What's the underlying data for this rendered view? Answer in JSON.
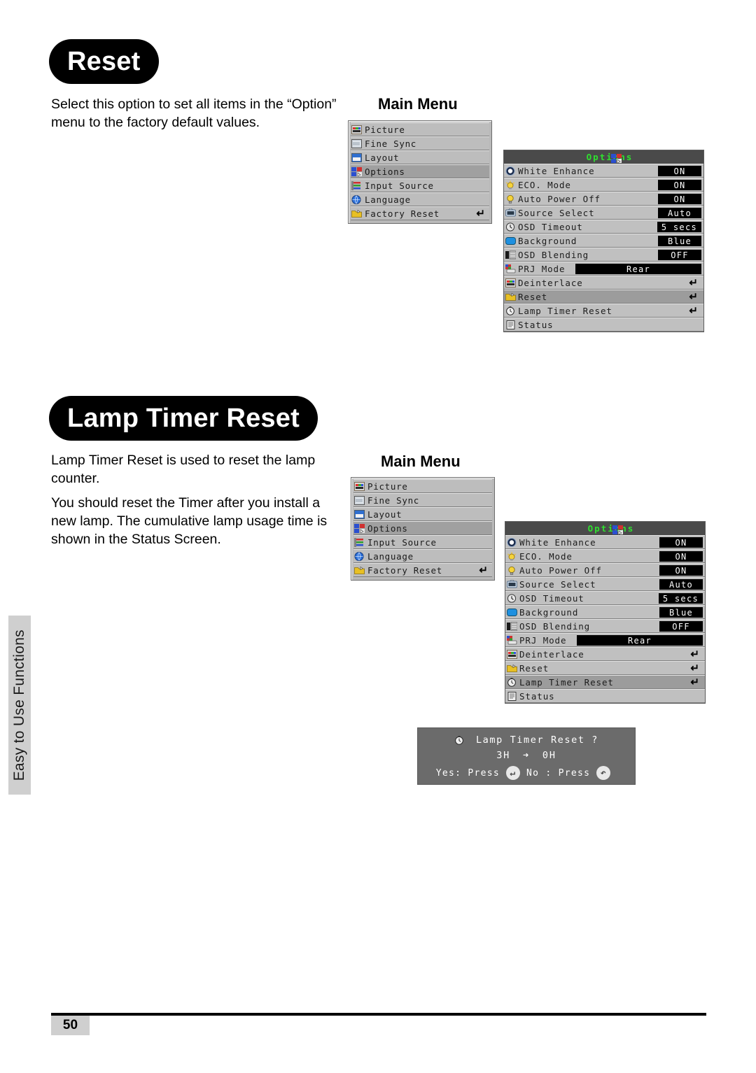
{
  "page": {
    "number": "50",
    "side_tab": "Easy to Use Functions"
  },
  "sections": [
    {
      "heading": "Reset",
      "paragraphs": [
        "Select this option to set all items in the “Option” menu to the factory default values."
      ],
      "menu_caption": "Main Menu"
    },
    {
      "heading": "Lamp Timer Reset",
      "paragraphs": [
        "Lamp Timer Reset is used to reset the lamp counter.",
        "You should reset the Timer after you install a new lamp. The cumulative lamp usage time is shown in the Status Screen."
      ],
      "menu_caption": "Main Menu"
    }
  ],
  "main_menu": {
    "items": [
      {
        "label": "Picture",
        "icon": "picture-icon",
        "selected": false,
        "enter": ""
      },
      {
        "label": "Fine Sync",
        "icon": "fine-sync-icon",
        "selected": false,
        "enter": ""
      },
      {
        "label": "Layout",
        "icon": "layout-icon",
        "selected": false,
        "enter": ""
      },
      {
        "label": "Options",
        "icon": "options-icon",
        "selected": true,
        "enter": ""
      },
      {
        "label": "Input Source",
        "icon": "input-source-icon",
        "selected": false,
        "enter": ""
      },
      {
        "label": "Language",
        "icon": "language-icon",
        "selected": false,
        "enter": ""
      },
      {
        "label": "Factory Reset",
        "icon": "folder-icon",
        "selected": false,
        "enter": "↵"
      }
    ]
  },
  "options_menu": {
    "title": "Options",
    "title_icon": "options-icon",
    "rows": [
      {
        "label": "White Enhance",
        "icon": "white-enhance-icon",
        "value": "ON",
        "value_wide": false,
        "enter": ""
      },
      {
        "label": "ECO. Mode",
        "icon": "eco-mode-icon",
        "value": "ON",
        "value_wide": false,
        "enter": ""
      },
      {
        "label": "Auto Power Off",
        "icon": "lamp-icon",
        "value": "ON",
        "value_wide": false,
        "enter": ""
      },
      {
        "label": "Source Select",
        "icon": "source-select-icon",
        "value": "Auto",
        "value_wide": false,
        "enter": ""
      },
      {
        "label": "OSD Timeout",
        "icon": "clock-icon",
        "value": "5 secs",
        "value_wide": false,
        "enter": ""
      },
      {
        "label": "Background",
        "icon": "background-icon",
        "value": "Blue",
        "value_wide": false,
        "enter": ""
      },
      {
        "label": "OSD Blending",
        "icon": "osd-blending-icon",
        "value": "OFF",
        "value_wide": false,
        "enter": ""
      },
      {
        "label": "PRJ Mode",
        "icon": "prj-mode-icon",
        "value": "Rear",
        "value_wide": true,
        "enter": ""
      },
      {
        "label": "Deinterlace",
        "icon": "deinterlace-icon",
        "value": "",
        "value_wide": false,
        "enter": "↵"
      },
      {
        "label": "Reset",
        "icon": "folder-icon",
        "value": "",
        "value_wide": false,
        "enter": "↵"
      },
      {
        "label": "Lamp Timer Reset",
        "icon": "timer-icon",
        "value": "",
        "value_wide": false,
        "enter": "↵"
      },
      {
        "label": "Status",
        "icon": "status-icon",
        "value": "",
        "value_wide": false,
        "enter": ""
      }
    ],
    "selected_row_top": "Reset",
    "selected_row_bottom": "Lamp Timer Reset"
  },
  "lamp_dialog": {
    "icon": "timer-icon",
    "title": "Lamp Timer Reset ?",
    "from_hours": "3H",
    "arrow": "➜",
    "to_hours": "0H",
    "yes_label": "Yes: Press",
    "yes_button_icon": "enter-button-icon",
    "yes_button_glyph": "↵",
    "no_label": "No : Press",
    "no_button_icon": "back-button-icon",
    "no_button_glyph": "↶"
  },
  "colors": {
    "panel_bg": "#c0c0c0",
    "panel_selected": "#9c9c9c",
    "title_bar": "#4a4a4a",
    "title_text": "#2fe02f",
    "value_box_bg": "#000000",
    "value_box_text": "#ffffff",
    "dialog_bg": "#6b6b6b",
    "side_tab_bg": "#cfcfcf"
  }
}
